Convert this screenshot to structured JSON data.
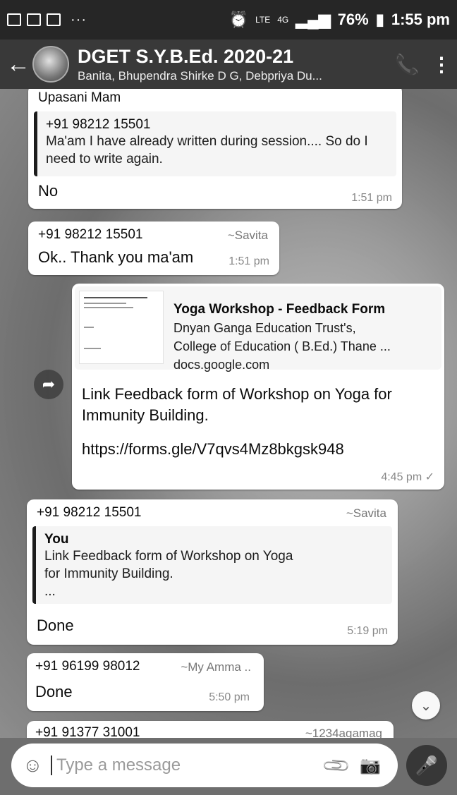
{
  "status_bar": {
    "dots": "···",
    "network_lte": "LTE",
    "network_4g": "4G",
    "battery": "76%",
    "time": "1:55 pm"
  },
  "header": {
    "title": "DGET S.Y.B.Ed. 2020-21",
    "members": "Banita, Bhupendra Shirke D G, Debpriya Du..."
  },
  "messages": {
    "m1": {
      "sender_name": "Upasani Mam",
      "quote_author": "+91 98212 15501",
      "quote_text": "Ma'am I have already written during session.... So do I need to write again.",
      "text": "No",
      "time": "1:51 pm"
    },
    "m2": {
      "sender": "+91 98212 15501",
      "sender_name": "~Savita",
      "text": "Ok.. Thank you ma'am",
      "time": "1:51 pm"
    },
    "m3": {
      "link_title": "Yoga Workshop - Feedback Form",
      "link_desc1": "Dnyan Ganga Education Trust's,",
      "link_desc2": "College of Education ( B.Ed.) Thane ...",
      "link_domain": "docs.google.com",
      "text": "Link Feedback form of Workshop on Yoga for Immunity Building.",
      "url": "https://forms.gle/V7qvs4Mz8bkgsk948",
      "time": "4:45 pm ✓"
    },
    "m4": {
      "sender": "+91 98212 15501",
      "sender_name": "~Savita",
      "quote_author": "You",
      "quote_text": "Link Feedback form of Workshop on Yoga for Immunity Building.",
      "quote_more": "...",
      "text": "Done",
      "time": "5:19 pm"
    },
    "m5": {
      "sender": "+91 96199 98012",
      "sender_name": "~My Amma ..",
      "text": "Done",
      "time": "5:50 pm"
    },
    "m6": {
      "sender": "+91 91377 31001",
      "sender_name": "~1234agamag"
    }
  },
  "input": {
    "placeholder": "Type a message"
  }
}
